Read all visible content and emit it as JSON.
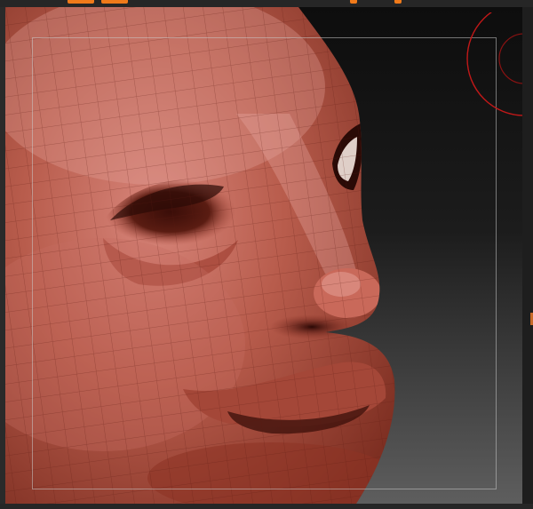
{
  "app": {
    "accent_color": "#f07a1a",
    "viewport_background_top": "#0e0e0e",
    "viewport_background_bottom": "#5a5a5a",
    "mesh_color": "#b8523f",
    "frame_color": "#c8c8c8",
    "gizmo_color": "#c01818"
  },
  "toolbar": {
    "tabs": [
      {
        "name": "tool-tab-1"
      },
      {
        "name": "tool-tab-2"
      },
      {
        "name": "tool-tab-3"
      },
      {
        "name": "tool-tab-4"
      }
    ]
  },
  "viewport": {
    "subject": "sculpt-mesh-face",
    "gizmo_icon": "rotation-gizmo-icon"
  }
}
